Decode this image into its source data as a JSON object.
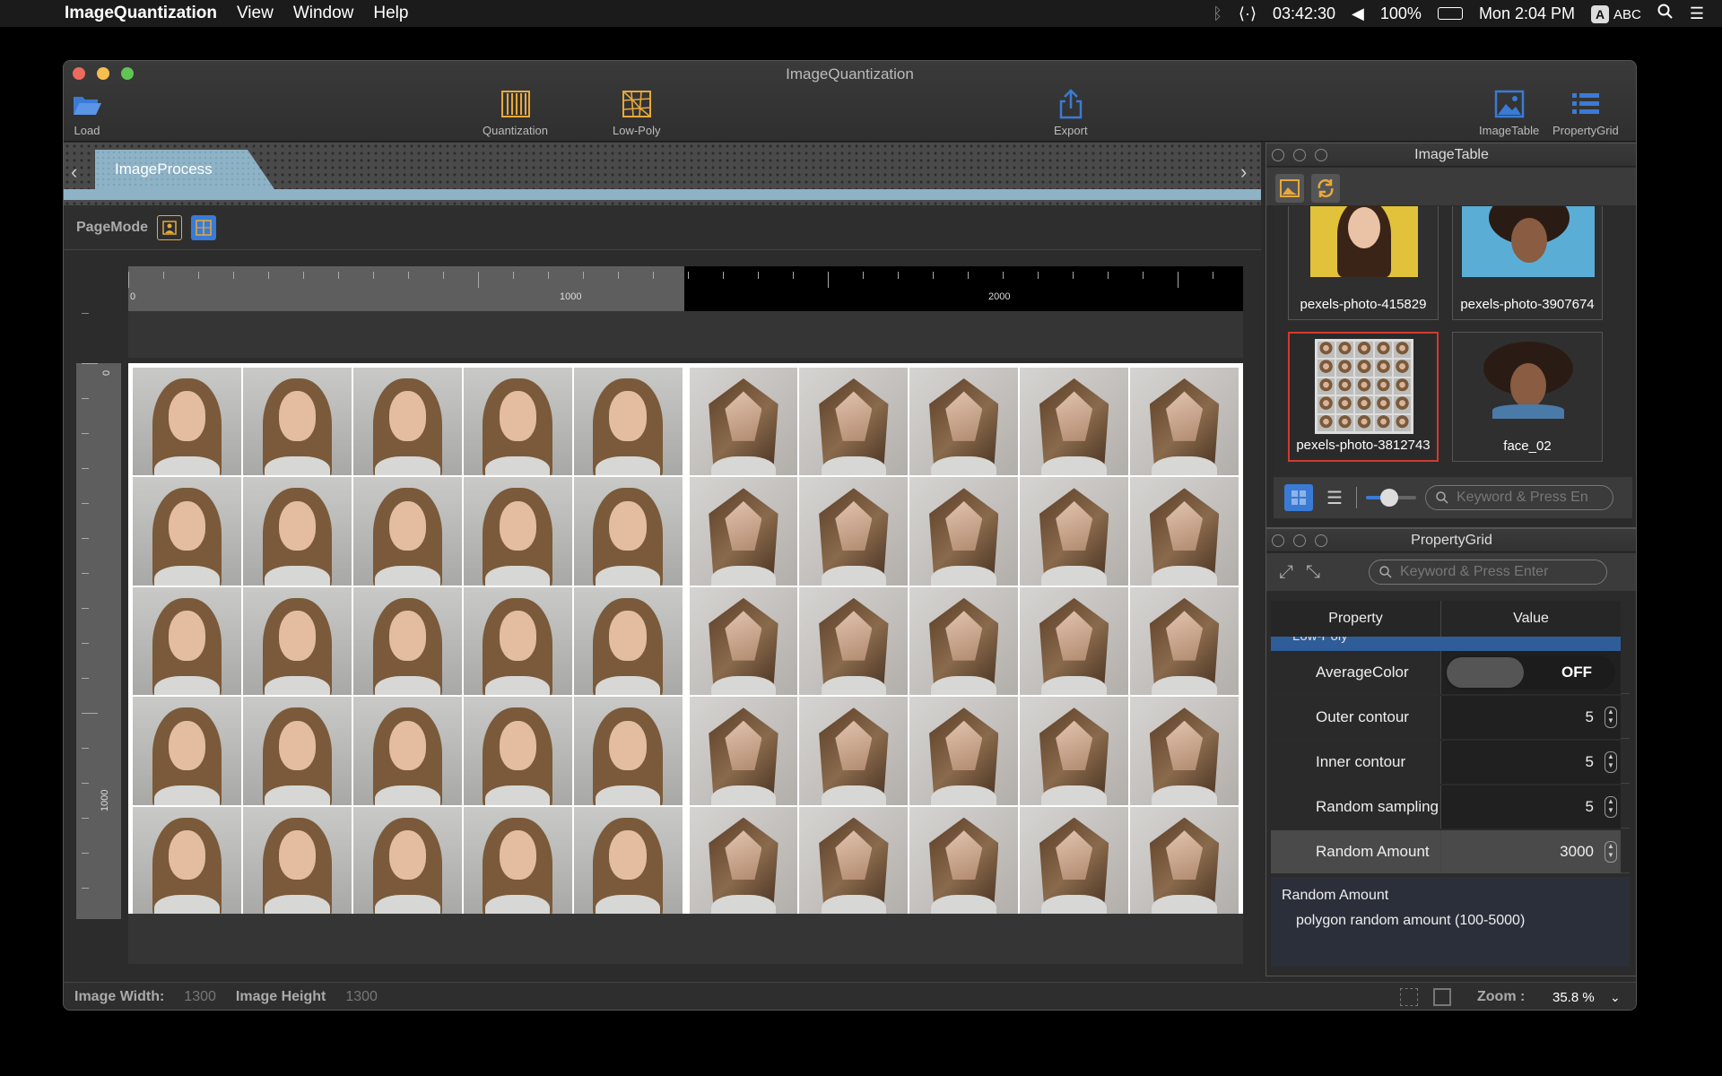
{
  "menubar": {
    "app_name": "ImageQuantization",
    "menus": [
      "View",
      "Window",
      "Help"
    ],
    "timer": "03:42:30",
    "battery": "100%",
    "clock": "Mon 2:04 PM",
    "input_source": "ABC",
    "input_badge": "A"
  },
  "window": {
    "title": "ImageQuantization",
    "toolbar": {
      "load": "Load",
      "quantization": "Quantization",
      "low_poly": "Low-Poly",
      "export": "Export",
      "image_table": "ImageTable",
      "property_grid": "PropertyGrid"
    }
  },
  "tabs": {
    "active": "ImageProcess"
  },
  "page_mode": {
    "label": "PageMode"
  },
  "rulers": {
    "h_labels": [
      "0",
      "1000",
      "2000"
    ],
    "v_labels": [
      "0",
      "1000"
    ]
  },
  "status": {
    "width_label": "Image Width:",
    "width_value": "1300",
    "height_label": "Image Height",
    "height_value": "1300",
    "zoom_label": "Zoom :",
    "zoom_value": "35.8 %"
  },
  "image_table": {
    "title": "ImageTable",
    "items": [
      {
        "caption": "pexels-photo-415829"
      },
      {
        "caption": "pexels-photo-3907674"
      },
      {
        "caption": "pexels-photo-3812743"
      },
      {
        "caption": "face_02"
      }
    ],
    "search_placeholder": "Keyword & Press En"
  },
  "property_grid": {
    "title": "PropertyGrid",
    "search_placeholder": "Keyword & Press Enter",
    "col_property": "Property",
    "col_value": "Value",
    "category": "Low-Poly",
    "rows": [
      {
        "name": "AverageColor",
        "value": "OFF"
      },
      {
        "name": "Outer contour",
        "value": "5"
      },
      {
        "name": "Inner contour",
        "value": "5"
      },
      {
        "name": "Random sampling",
        "value": "5"
      },
      {
        "name": "Random Amount",
        "value": "3000"
      }
    ],
    "desc_title": "Random Amount",
    "desc_text": "polygon random amount (100-5000)"
  },
  "colors": {
    "accent_blue": "#3a7bd5",
    "toolbar_icon_yellow": "#e7a93c",
    "selected_border": "#d23a2e"
  }
}
